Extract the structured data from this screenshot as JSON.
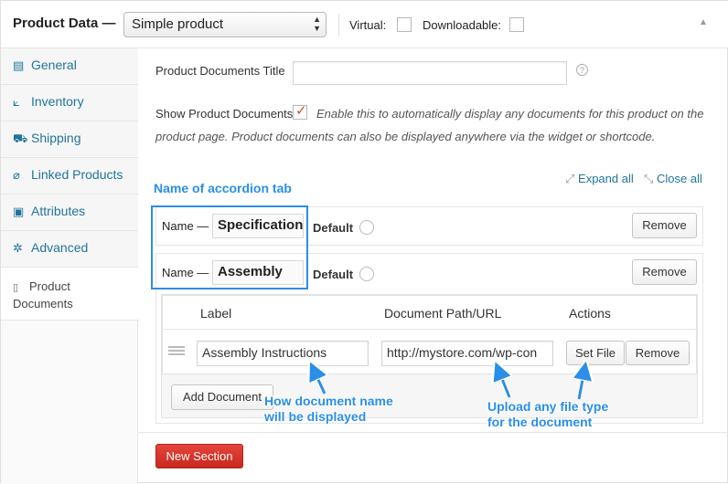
{
  "header": {
    "title": "Product Data —",
    "product_type": "Simple product",
    "virtual_label": "Virtual:",
    "downloadable_label": "Downloadable:"
  },
  "sidebar": {
    "items": [
      {
        "label": "General",
        "icon": "general-icon"
      },
      {
        "label": "Inventory",
        "icon": "inventory-icon"
      },
      {
        "label": "Shipping",
        "icon": "shipping-icon"
      },
      {
        "label": "Linked Products",
        "icon": "link-icon"
      },
      {
        "label": "Attributes",
        "icon": "attributes-icon"
      },
      {
        "label": "Advanced",
        "icon": "gear-icon"
      },
      {
        "label": "Product Documents",
        "icon": "document-icon",
        "active": true
      }
    ]
  },
  "main": {
    "docs_title_label": "Product Documents Title",
    "docs_title_value": "",
    "show_docs_label": "Show Product Documents",
    "show_docs_checked": true,
    "show_docs_help_1": "Enable this to automatically display any documents for this product on the",
    "show_docs_help_2": "product page. Product documents can also be displayed anywhere via the widget or shortcode.",
    "expand_all": "Expand all",
    "close_all": "Close all",
    "sections": [
      {
        "name_label": "Name —",
        "name_value": "Specification",
        "default_label": "Default",
        "remove_label": "Remove"
      },
      {
        "name_label": "Name —",
        "name_value": "Assembly",
        "default_label": "Default",
        "remove_label": "Remove"
      }
    ],
    "documents_table": {
      "columns": [
        "Label",
        "Document Path/URL",
        "Actions"
      ],
      "rows": [
        {
          "label": "Assembly Instructions",
          "path": "http://mystore.com/wp-con",
          "set_file": "Set File",
          "remove": "Remove"
        }
      ],
      "add_document": "Add Document"
    },
    "new_section": "New Section"
  },
  "annotations": {
    "accordion": "Name of accordion tab",
    "doc_name_1": "How document name",
    "doc_name_2": "will be displayed",
    "upload_1": "Upload any file type",
    "upload_2": "for the document"
  },
  "colors": {
    "accent_link": "#21759b",
    "annotation": "#2b8ee8",
    "new_section_button": "#d0342a",
    "checkmark": "#d54e21"
  }
}
